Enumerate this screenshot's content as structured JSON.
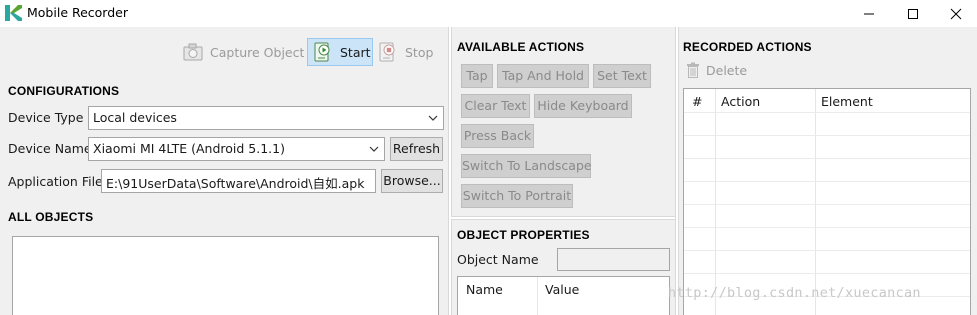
{
  "window": {
    "title": "Mobile Recorder"
  },
  "toolbar": {
    "capture_label": "Capture Object",
    "start_label": "Start",
    "stop_label": "Stop"
  },
  "configurations": {
    "title": "CONFIGURATIONS",
    "device_type_label": "Device Type",
    "device_type_value": "Local devices",
    "device_name_label": "Device Name",
    "device_name_value": "Xiaomi MI 4LTE (Android 5.1.1)",
    "refresh_label": "Refresh",
    "app_file_label": "Application File",
    "app_file_value": "E:\\91UserData\\Software\\Android\\自如.apk",
    "browse_label": "Browse..."
  },
  "all_objects": {
    "title": "ALL OBJECTS"
  },
  "available_actions": {
    "title": "AVAILABLE ACTIONS",
    "buttons": [
      "Tap",
      "Tap And Hold",
      "Set Text",
      "Clear Text",
      "Hide Keyboard",
      "Press Back",
      "Switch To Landscape",
      "Switch To Portrait"
    ]
  },
  "object_properties": {
    "title": "OBJECT PROPERTIES",
    "object_name_label": "Object Name",
    "columns": [
      "Name",
      "Value"
    ]
  },
  "recorded_actions": {
    "title": "RECORDED ACTIONS",
    "delete_label": "Delete",
    "columns": [
      "#",
      "Action",
      "Element"
    ]
  },
  "watermark": "http://blog.csdn.net/xuecancan",
  "colors": {
    "accent": "#cce4f7",
    "accent_border": "#99c9ef",
    "logo_teal": "#2aa8a0",
    "logo_green": "#5aa532"
  }
}
